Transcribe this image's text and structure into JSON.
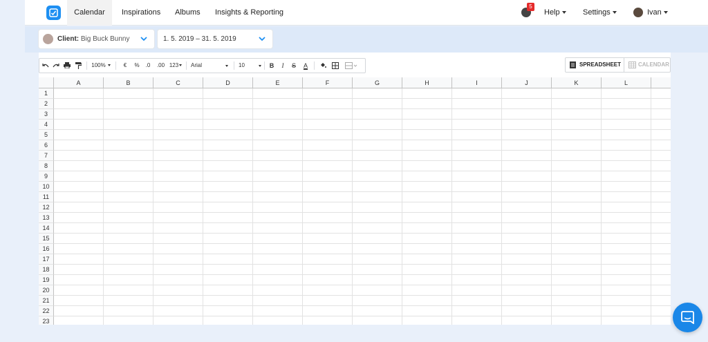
{
  "nav": {
    "items": [
      {
        "label": "Calendar",
        "active": true
      },
      {
        "label": "Inspirations"
      },
      {
        "label": "Albums"
      },
      {
        "label": "Insights & Reporting"
      }
    ],
    "notifications": "5",
    "help": "Help",
    "settings": "Settings",
    "user": "Ivan"
  },
  "filters": {
    "client_label": "Client:",
    "client_name": "Big Buck Bunny",
    "date_range": "1. 5. 2019 – 31. 5. 2019"
  },
  "toolbar": {
    "zoom": "100%",
    "currency": "€",
    "percent": "%",
    "dec_decrease": ".0",
    "dec_increase": ".00",
    "number_format": "123",
    "font": "Arial",
    "font_size": "10",
    "bold": "B",
    "italic": "I",
    "strike": "S",
    "text_color": "A"
  },
  "view": {
    "spreadsheet": "SPREADSHEET",
    "calendar": "CALENDAR"
  },
  "sheet": {
    "columns": [
      "A",
      "B",
      "C",
      "D",
      "E",
      "F",
      "G",
      "H",
      "I",
      "J",
      "K",
      "L"
    ],
    "rows": [
      "1",
      "2",
      "3",
      "4",
      "5",
      "6",
      "7",
      "8",
      "9",
      "10",
      "11",
      "12",
      "13",
      "14",
      "15",
      "16",
      "17",
      "18",
      "19",
      "20",
      "21",
      "22",
      "23"
    ]
  },
  "colors": {
    "accent": "#1d8ff2",
    "badge": "#e52b2b",
    "filter_bg": "#dde9f9"
  }
}
